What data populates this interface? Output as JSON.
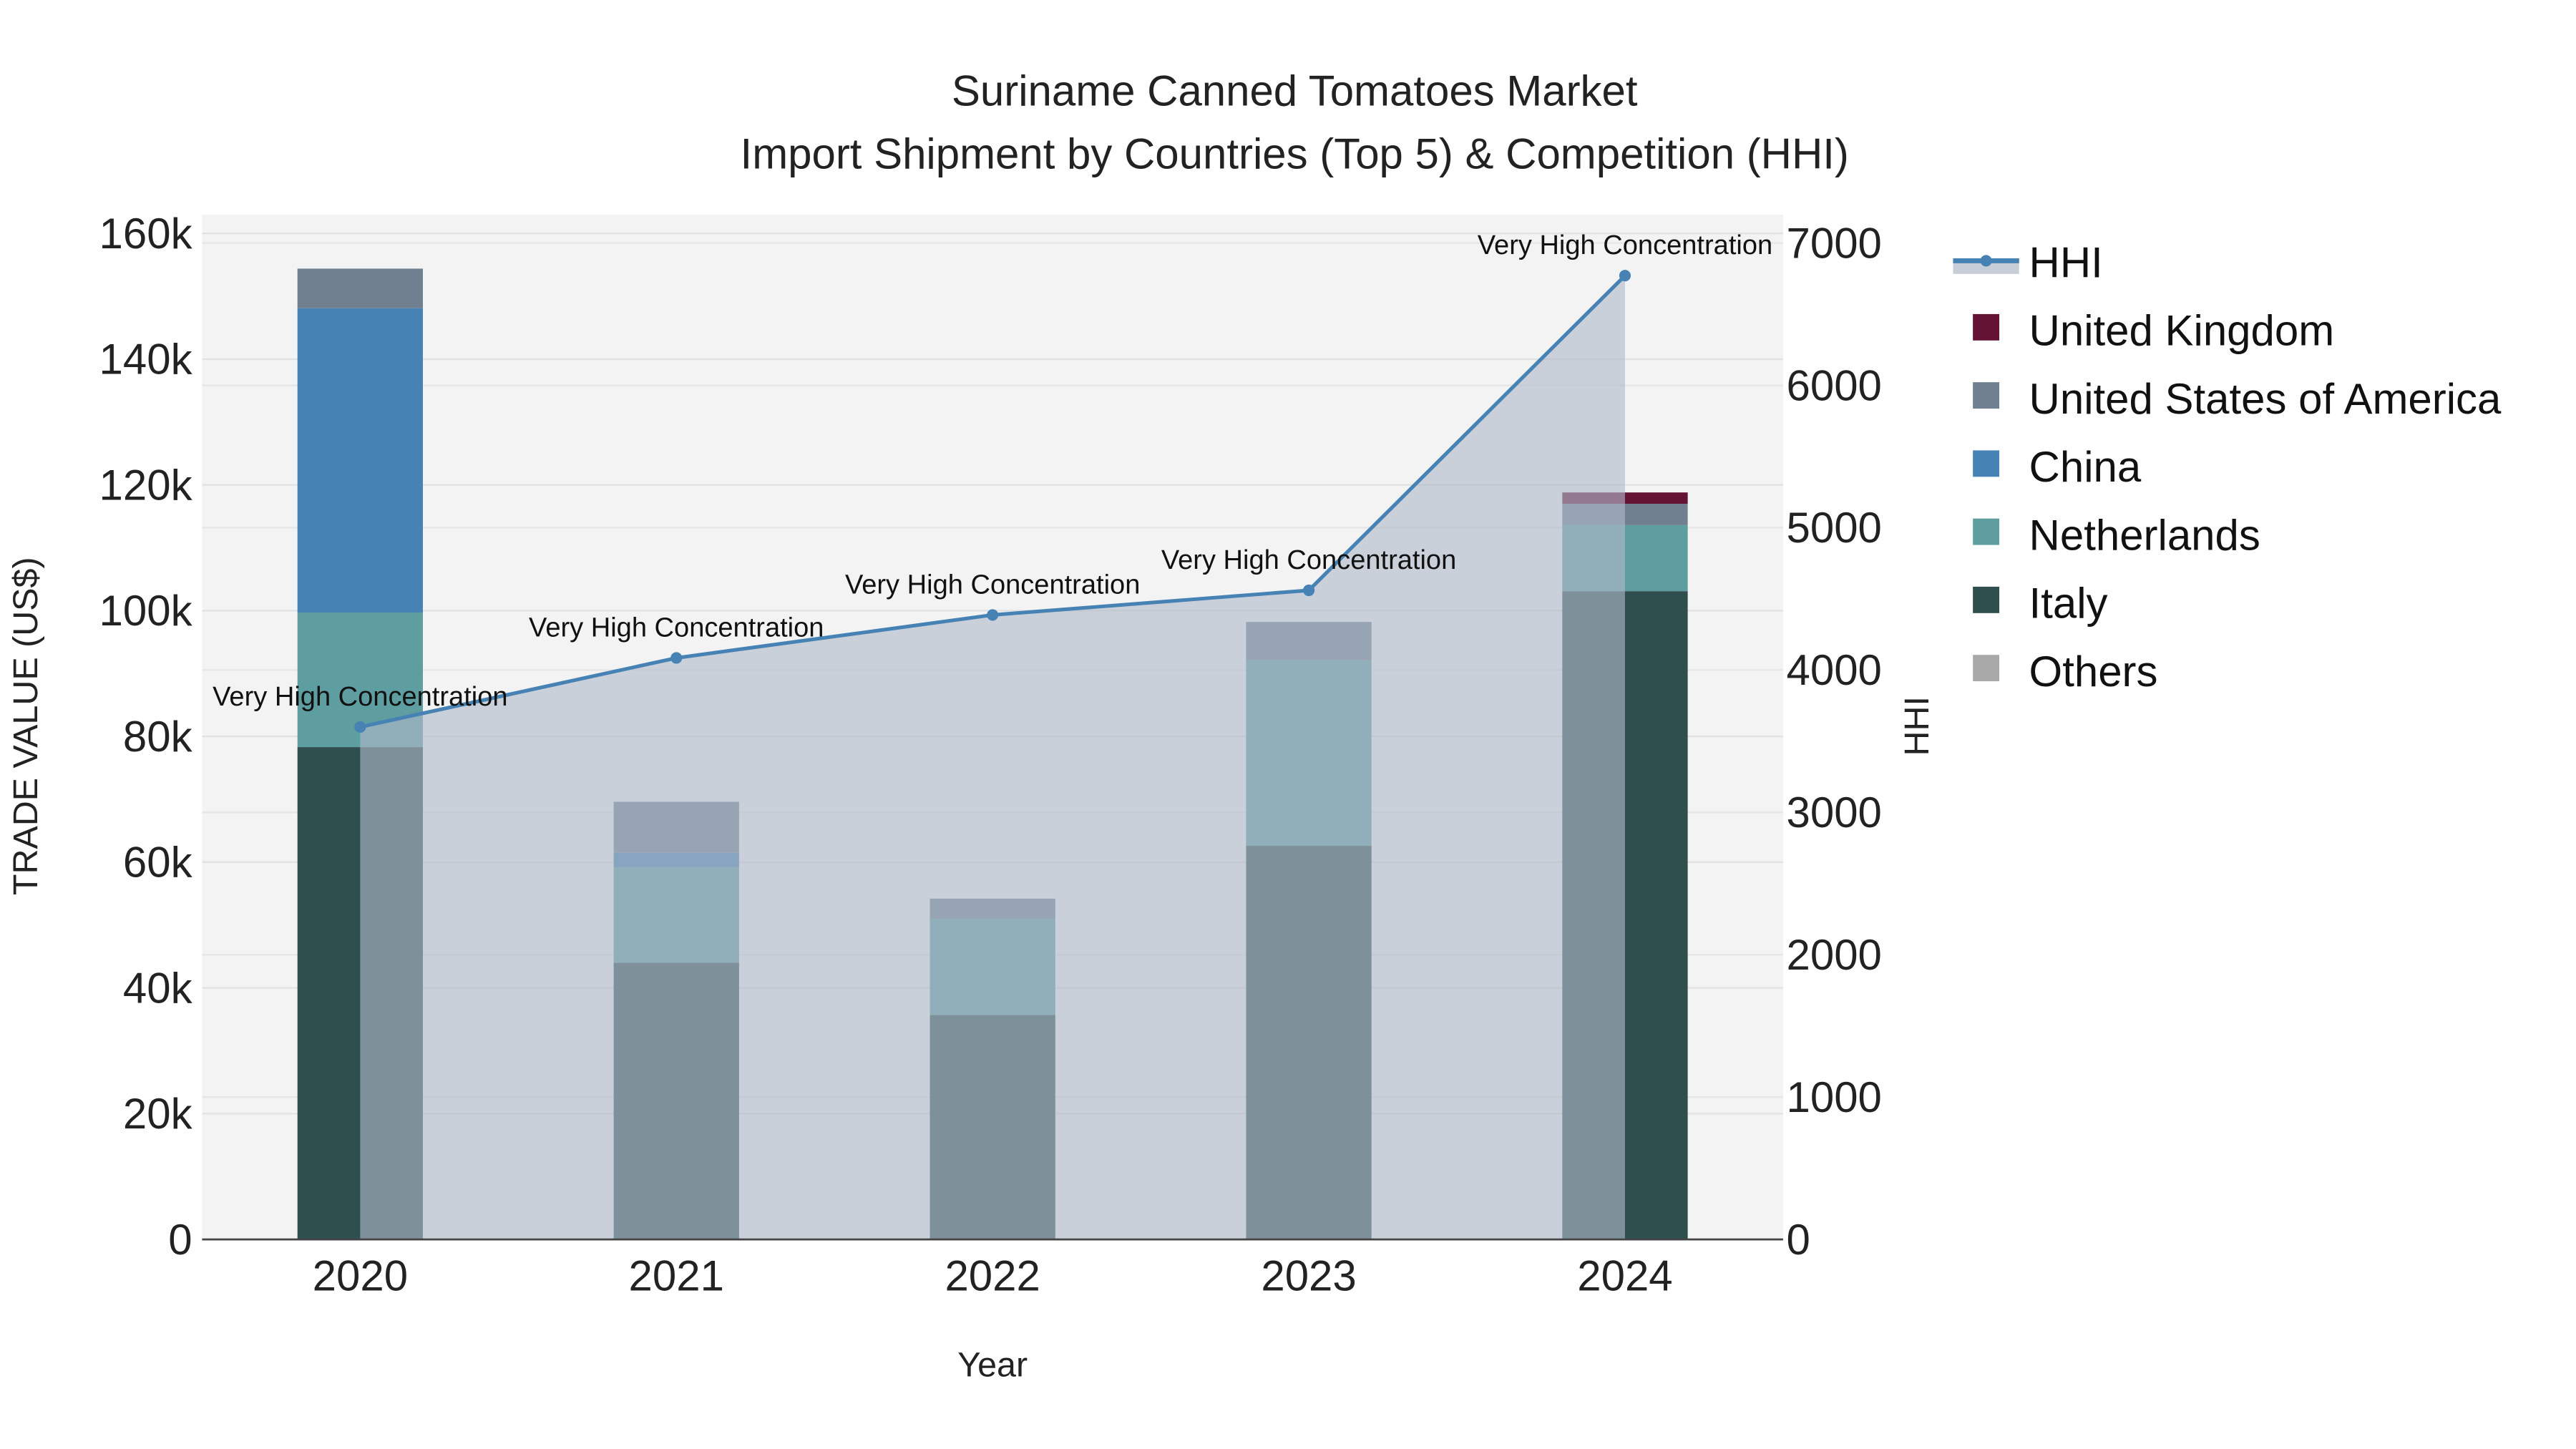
{
  "chart_data": {
    "type": "bar",
    "stacked": true,
    "title": "Suriname Canned Tomatoes Market",
    "subtitle": "Import Shipment by Countries (Top 5) & Competition (HHI)",
    "xlabel": "Year",
    "ylabel": "TRADE VALUE (US$)",
    "y2label": "HHI",
    "categories": [
      "2020",
      "2021",
      "2022",
      "2023",
      "2024"
    ],
    "ylim": [
      0,
      163000
    ],
    "y2lim": [
      0,
      7200
    ],
    "yticks": [
      0,
      20000,
      40000,
      60000,
      80000,
      100000,
      120000,
      140000,
      160000
    ],
    "ytick_labels": [
      "0",
      "20k",
      "40k",
      "60k",
      "80k",
      "100k",
      "120k",
      "140k",
      "160k"
    ],
    "y2ticks": [
      0,
      1000,
      2000,
      3000,
      4000,
      5000,
      6000,
      7000
    ],
    "y2tick_labels": [
      "0",
      "1000",
      "2000",
      "3000",
      "4000",
      "5000",
      "6000",
      "7000"
    ],
    "grid": true,
    "legend_position": "right",
    "series": [
      {
        "name": "Italy",
        "color": "#2f4f4f",
        "values": [
          78300,
          44000,
          35700,
          62600,
          103100
        ]
      },
      {
        "name": "Netherlands",
        "color": "#5f9ea0",
        "values": [
          21400,
          15200,
          15300,
          29500,
          10500
        ]
      },
      {
        "name": "China",
        "color": "#4682b4",
        "values": [
          48400,
          2300,
          0,
          0,
          0
        ]
      },
      {
        "name": "United States of America",
        "color": "#708090",
        "values": [
          6300,
          8100,
          3200,
          6100,
          3400
        ]
      },
      {
        "name": "United Kingdom",
        "color": "#641335",
        "values": [
          0,
          0,
          0,
          0,
          1800
        ]
      },
      {
        "name": "Others",
        "color": "#a9a9a9",
        "values": [
          0,
          0,
          0,
          0,
          0
        ]
      }
    ],
    "line_series": {
      "name": "HHI",
      "color": "#4682b4",
      "axis": "y2",
      "values": [
        3600,
        4085,
        4387,
        4560,
        6771
      ],
      "annotations": [
        "Very High Concentration",
        "Very High Concentration",
        "Very High Concentration",
        "Very High Concentration",
        "Very High Concentration"
      ]
    },
    "legend_order": [
      "HHI",
      "United Kingdom",
      "United States of America",
      "China",
      "Netherlands",
      "Italy",
      "Others"
    ]
  }
}
